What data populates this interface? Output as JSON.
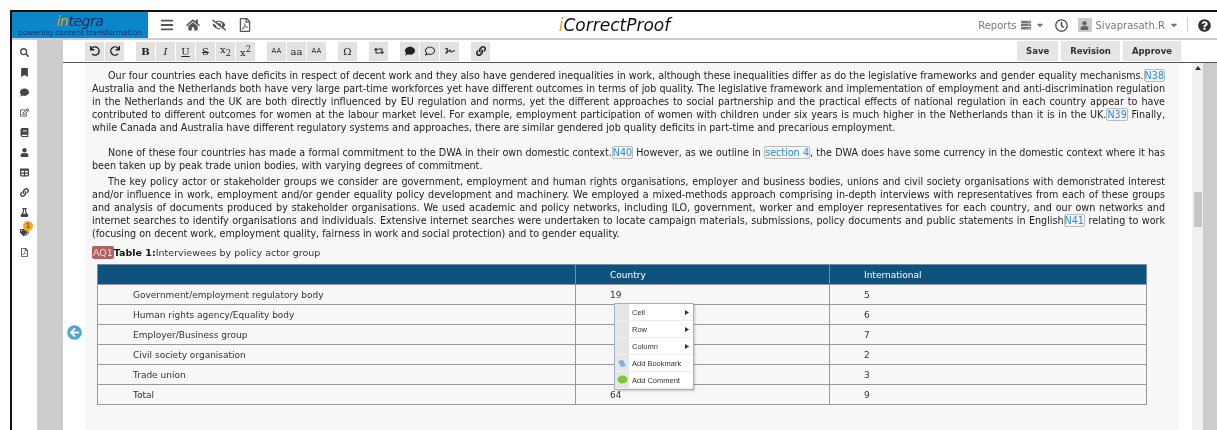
{
  "header": {
    "logo": {
      "accent": "in",
      "text": "tegra",
      "tagline": "powering content transformation"
    },
    "title": {
      "accent": "i",
      "text": "CorrectProof"
    },
    "reports": "Reports",
    "user": "Sivaprasath.R"
  },
  "sidebar": [
    {
      "kind": "search"
    },
    {
      "kind": "bookmark"
    },
    {
      "kind": "comment"
    },
    {
      "kind": "edit"
    },
    {
      "kind": "book"
    },
    {
      "kind": "user"
    },
    {
      "kind": "table"
    },
    {
      "kind": "link"
    },
    {
      "kind": "flask"
    },
    {
      "kind": "tag",
      "badge": "1"
    },
    {
      "kind": "file"
    }
  ],
  "toolbar": [
    [
      {
        "kind": "undo"
      },
      {
        "kind": "redo"
      }
    ],
    [
      {
        "kind": "bold",
        "label": "B"
      },
      {
        "kind": "italic",
        "label": "I"
      },
      {
        "kind": "underline",
        "label": "U"
      },
      {
        "kind": "strike",
        "label": "S"
      },
      {
        "kind": "plain",
        "label": "x$_{2}$"
      },
      {
        "kind": "plain",
        "label": "x$^{2}$"
      }
    ],
    [
      {
        "kind": "caps",
        "label": "AA"
      },
      {
        "kind": "plain",
        "label": "aa"
      },
      {
        "kind": "caps",
        "label": "AA"
      }
    ],
    [
      {
        "kind": "plain",
        "label": "Ω"
      }
    ],
    [
      {
        "kind": "swap"
      }
    ],
    [
      {
        "kind": "comment"
      },
      {
        "kind": "comment-outline"
      },
      {
        "kind": "signature"
      }
    ],
    [
      {
        "kind": "link"
      }
    ]
  ],
  "actions": [
    "Save",
    "Revision",
    "Approve"
  ],
  "paragraphs": [
    [
      {
        "kind": "text",
        "text": "Our four countries each have deficits in respect of decent work and they also have gendered inequalities in work, although these inequalities differ as do the legislative frameworks and gender equality mechanisms."
      },
      {
        "kind": "ref",
        "text": "N38"
      },
      {
        "kind": "text",
        "text": " Australia and the Netherlands both have very large part-time workforces yet have different outcomes in terms of job quality. The legislative framework and implementation of employment and anti-discrimination regulation in the Netherlands and the UK are both directly influenced by EU regulation and norms, yet the different approaches to social partnership and the practical effects of national regulation in each country appear to have contributed to different outcomes for women at the labour market level. For example, employment participation of women with children under six years is much higher in the Netherlands than it is in the UK."
      },
      {
        "kind": "ref",
        "text": "N39"
      },
      {
        "kind": "text",
        "text": " Finally, while Canada and Australia have different regulatory systems and approaches, there are similar gendered job quality deficits in part-time and precarious employment."
      }
    ],
    [
      {
        "kind": "text",
        "text": "None of these four countries has made a formal commitment to the DWA in their own domestic context."
      },
      {
        "kind": "ref",
        "text": "N40"
      },
      {
        "kind": "text",
        "text": " However, as we outline in "
      },
      {
        "kind": "ref",
        "text": "section 4"
      },
      {
        "kind": "text",
        "text": ", the DWA does have some currency in the domestic context where it has been taken up by peak trade union bodies, with varying degrees of commitment."
      }
    ],
    [
      {
        "kind": "text",
        "text": "The key policy actor or stakeholder groups we consider are government, employment and human rights organisations, employer and business bodies, unions and civil society organisations with demonstrated interest and/or influence in work, employment and/or gender equality policy development and machinery. We employed a mixed-methods approach comprising in-depth interviews with representatives from each of these groups and analysis of documents produced by stakeholder organisations. We used academic and policy networks, including ILO, government, worker and employer representatives for each country, and our own networks and internet searches to identify organisations and individuals. Extensive internet searches were undertaken to locate campaign materials, submissions, policy documents and public statements in English"
      },
      {
        "kind": "ref",
        "text": "N41"
      },
      {
        "kind": "text",
        "text": " relating to work (focusing on decent work, employment quality, fairness in work and social protection) and to gender equality."
      }
    ]
  ],
  "caption": {
    "query": "AQ1",
    "label": "Table 1:",
    "text": "Interviewees by policy actor group"
  },
  "table": {
    "columns": [
      "",
      "Country",
      "International"
    ],
    "rows": [
      [
        "Government/employment regulatory body",
        "19",
        "5"
      ],
      [
        "Human rights agency/Equality body",
        "",
        "6"
      ],
      [
        "Employer/Business group",
        "",
        "7"
      ],
      [
        "Civil society organisation",
        "",
        "2"
      ],
      [
        "Trade union",
        "",
        "3"
      ],
      [
        "Total",
        "64",
        "9"
      ]
    ]
  },
  "context_menu": [
    {
      "kind": "submenu",
      "label": "Cell"
    },
    {
      "kind": "submenu",
      "label": "Row"
    },
    {
      "kind": "submenu",
      "label": "Column"
    },
    {
      "kind": "bookmark",
      "label": "Add Bookmark"
    },
    {
      "kind": "comment",
      "label": "Add Comment"
    }
  ]
}
